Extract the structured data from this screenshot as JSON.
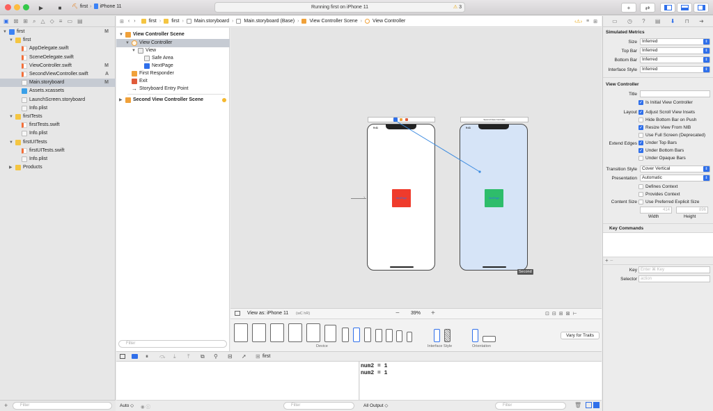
{
  "toolbar": {
    "scheme_project": "first",
    "scheme_device": "iPhone 11",
    "status": "Running first on iPhone 11",
    "warnings": "3"
  },
  "navigator": {
    "items": [
      {
        "label": "first",
        "badge": "M",
        "indent": 0,
        "kind": "project",
        "open": true
      },
      {
        "label": "first",
        "badge": "",
        "indent": 1,
        "kind": "folder",
        "open": true
      },
      {
        "label": "AppDelegate.swift",
        "badge": "",
        "indent": 2,
        "kind": "swift"
      },
      {
        "label": "SceneDelegate.swift",
        "badge": "",
        "indent": 2,
        "kind": "swift"
      },
      {
        "label": "ViewController.swift",
        "badge": "M",
        "indent": 2,
        "kind": "swift"
      },
      {
        "label": "SecondViewController.swift",
        "badge": "A",
        "indent": 2,
        "kind": "swift"
      },
      {
        "label": "Main.storyboard",
        "badge": "M",
        "indent": 2,
        "kind": "storyboard",
        "selected": true
      },
      {
        "label": "Assets.xcassets",
        "badge": "",
        "indent": 2,
        "kind": "assets"
      },
      {
        "label": "LaunchScreen.storyboard",
        "badge": "",
        "indent": 2,
        "kind": "storyboard"
      },
      {
        "label": "Info.plist",
        "badge": "",
        "indent": 2,
        "kind": "plist"
      },
      {
        "label": "firstTests",
        "badge": "",
        "indent": 1,
        "kind": "folder",
        "open": true
      },
      {
        "label": "firstTests.swift",
        "badge": "",
        "indent": 2,
        "kind": "swift"
      },
      {
        "label": "Info.plist",
        "badge": "",
        "indent": 2,
        "kind": "plist"
      },
      {
        "label": "firstUITests",
        "badge": "",
        "indent": 1,
        "kind": "folder",
        "open": true
      },
      {
        "label": "firstUITests.swift",
        "badge": "",
        "indent": 2,
        "kind": "swift"
      },
      {
        "label": "Info.plist",
        "badge": "",
        "indent": 2,
        "kind": "plist"
      },
      {
        "label": "Products",
        "badge": "",
        "indent": 1,
        "kind": "folder",
        "open": false
      }
    ],
    "filter_placeholder": "Filter"
  },
  "jumpbar": {
    "crumbs": [
      "first",
      "first",
      "Main.storyboard",
      "Main.storyboard (Base)",
      "View Controller Scene",
      "View Controller"
    ]
  },
  "outline": {
    "items": [
      {
        "label": "View Controller Scene",
        "indent": 0,
        "bold": true,
        "kind": "scene",
        "open": true
      },
      {
        "label": "View Controller",
        "indent": 1,
        "kind": "vc",
        "open": true,
        "selected": true
      },
      {
        "label": "View",
        "indent": 2,
        "kind": "view",
        "open": true
      },
      {
        "label": "Safe Area",
        "indent": 3,
        "kind": "safe"
      },
      {
        "label": "NextPage",
        "indent": 3,
        "kind": "button"
      },
      {
        "label": "First Responder",
        "indent": 1,
        "kind": "responder"
      },
      {
        "label": "Exit",
        "indent": 1,
        "kind": "exit"
      },
      {
        "label": "Storyboard Entry Point",
        "indent": 1,
        "kind": "arrow"
      },
      {
        "label": "Second View Controller Scene",
        "indent": 0,
        "bold": true,
        "kind": "scene",
        "open": false
      }
    ],
    "filter_placeholder": "Filter"
  },
  "canvas": {
    "phone1_time": "9:41",
    "phone2_time": "9:41",
    "scene2_title": "Second View Controller",
    "button1_label": "NextPage",
    "button2_label": "NextPage",
    "scene_tag": "Second",
    "colors": {
      "red": "#ef3b2c",
      "green": "#2ebd6b",
      "bluebg": "#d6e4f7",
      "segue": "#3c8be0"
    }
  },
  "device_bar": {
    "view_as": "View as: iPhone 11",
    "shortcut": "(wC hR)",
    "zoom": "39%",
    "device_label": "Device",
    "style_label": "Interface Style",
    "orientation_label": "Orientation",
    "vary_button": "Vary for Traits"
  },
  "debug": {
    "scheme": "first",
    "auto": "Auto",
    "filter_placeholder": "Filter",
    "output": "All Output"
  },
  "console": {
    "lines": [
      "num2 = 1",
      "num2 = 1"
    ]
  },
  "inspector": {
    "sim_header": "Simulated Metrics",
    "size_label": "Size",
    "size_value": "Inferred",
    "topbar_label": "Top Bar",
    "topbar_value": "Inferred",
    "bottombar_label": "Bottom Bar",
    "bottombar_value": "Inferred",
    "style_label": "Interface Style",
    "style_value": "Inferred",
    "vc_header": "View Controller",
    "title_label": "Title",
    "initial_vc": "Is Initial View Controller",
    "layout_label": "Layout",
    "adjust_insets": "Adjust Scroll View Insets",
    "hide_bottom": "Hide Bottom Bar on Push",
    "resize_nib": "Resize View From NIB",
    "full_screen": "Use Full Screen (Deprecated)",
    "extend_label": "Extend Edges",
    "under_top": "Under Top Bars",
    "under_bottom": "Under Bottom Bars",
    "under_opaque": "Under Opaque Bars",
    "transition_label": "Transition Style",
    "transition_value": "Cover Vertical",
    "presentation_label": "Presentation",
    "presentation_value": "Automatic",
    "defines_context": "Defines Context",
    "provides_context": "Provides Context",
    "content_size_label": "Content Size",
    "preferred_size": "Use Preferred Explicit Size",
    "width_value": "414",
    "height_value": "896",
    "width_label": "Width",
    "height_label": "Height",
    "key_commands": "Key Commands",
    "key_label": "Key",
    "key_placeholder": "Enter ⌘ Key",
    "selector_label": "Selector",
    "selector_placeholder": "action"
  }
}
